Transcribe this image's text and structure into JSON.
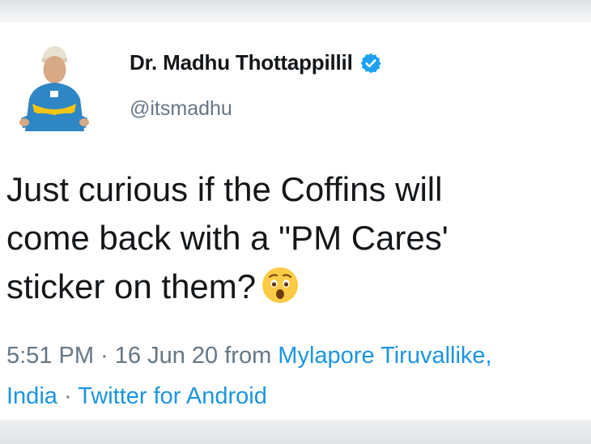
{
  "tweet": {
    "display_name": "Dr. Madhu Thottappillil",
    "handle": "@itsmadhu",
    "text_line1": "Just curious if the Coffins will",
    "text_line2": "come back with a \"PM Cares'",
    "text_line3": "sticker on them?",
    "time": "5:51 PM",
    "separator": " · ",
    "date": "16 Jun 20",
    "from_label": " from ",
    "location_part1": "Mylapore Tiruvallike,",
    "location_part2": "India",
    "source": "Twitter for Android"
  },
  "colors": {
    "text": "#14171a",
    "secondary": "#657786",
    "link": "#1b95e0",
    "verified": "#1da1f2"
  },
  "icons": {
    "verified": "verified-badge-icon",
    "emoji": "anxious-face-emoji-icon"
  }
}
